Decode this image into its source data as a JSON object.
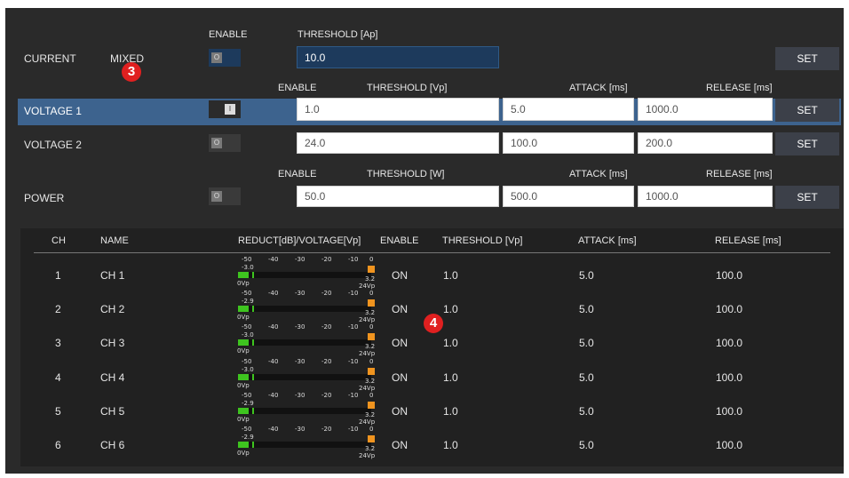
{
  "current": {
    "label": "CURRENT",
    "mode": "MIXED",
    "enable_header": "ENABLE",
    "threshold_header": "THRESHOLD [Ap]",
    "threshold_value": "10.0",
    "set_label": "SET"
  },
  "voltage_headers": {
    "enable": "ENABLE",
    "threshold": "THRESHOLD [Vp]",
    "attack": "ATTACK [ms]",
    "release": "RELEASE [ms]"
  },
  "voltage1": {
    "label": "VOLTAGE 1",
    "threshold": "1.0",
    "attack": "5.0",
    "release": "1000.0",
    "set_label": "SET",
    "toggle": "I"
  },
  "voltage2": {
    "label": "VOLTAGE 2",
    "threshold": "24.0",
    "attack": "100.0",
    "release": "200.0",
    "set_label": "SET",
    "toggle": "O"
  },
  "power_headers": {
    "enable": "ENABLE",
    "threshold": "THRESHOLD [W]",
    "attack": "ATTACK [ms]",
    "release": "RELEASE [ms]"
  },
  "power": {
    "label": "POWER",
    "threshold": "50.0",
    "attack": "500.0",
    "release": "1000.0",
    "set_label": "SET",
    "toggle": "O"
  },
  "current_toggle": "O",
  "badges": {
    "b3": "3",
    "b4": "4"
  },
  "table": {
    "headers": {
      "ch": "CH",
      "name": "NAME",
      "reduct": "REDUCT[dB]/VOLTAGE[Vp]",
      "enable": "ENABLE",
      "threshold": "THRESHOLD [Vp]",
      "attack": "ATTACK [ms]",
      "release": "RELEASE [ms]"
    },
    "meter_scale": [
      "-50",
      "-40",
      "-30",
      "-20",
      "-10",
      "0"
    ],
    "meter_min_label": "0Vp",
    "meter_max_label": "24Vp",
    "rows": [
      {
        "ch": "1",
        "name": "CH 1",
        "peak": "-3.0",
        "voltage": "3.2",
        "level": 0.08,
        "enable": "ON",
        "threshold": "1.0",
        "attack": "5.0",
        "release": "100.0"
      },
      {
        "ch": "2",
        "name": "CH 2",
        "peak": "-2.9",
        "voltage": "3.2",
        "level": 0.08,
        "enable": "ON",
        "threshold": "1.0",
        "attack": "5.0",
        "release": "100.0"
      },
      {
        "ch": "3",
        "name": "CH 3",
        "peak": "-3.0",
        "voltage": "3.2",
        "level": 0.08,
        "enable": "ON",
        "threshold": "1.0",
        "attack": "5.0",
        "release": "100.0"
      },
      {
        "ch": "4",
        "name": "CH 4",
        "peak": "-3.0",
        "voltage": "3.2",
        "level": 0.08,
        "enable": "ON",
        "threshold": "1.0",
        "attack": "5.0",
        "release": "100.0"
      },
      {
        "ch": "5",
        "name": "CH 5",
        "peak": "-2.9",
        "voltage": "3.2",
        "level": 0.08,
        "enable": "ON",
        "threshold": "1.0",
        "attack": "5.0",
        "release": "100.0"
      },
      {
        "ch": "6",
        "name": "CH 6",
        "peak": "-2.9",
        "voltage": "3.2",
        "level": 0.08,
        "enable": "ON",
        "threshold": "1.0",
        "attack": "5.0",
        "release": "100.0"
      }
    ]
  },
  "colors": {
    "accent_selected": "#3d638e",
    "field_dark": "#1d3a5c",
    "meter_green": "#3ec41f",
    "meter_orange": "#f0941f",
    "badge_red": "#e02020"
  }
}
